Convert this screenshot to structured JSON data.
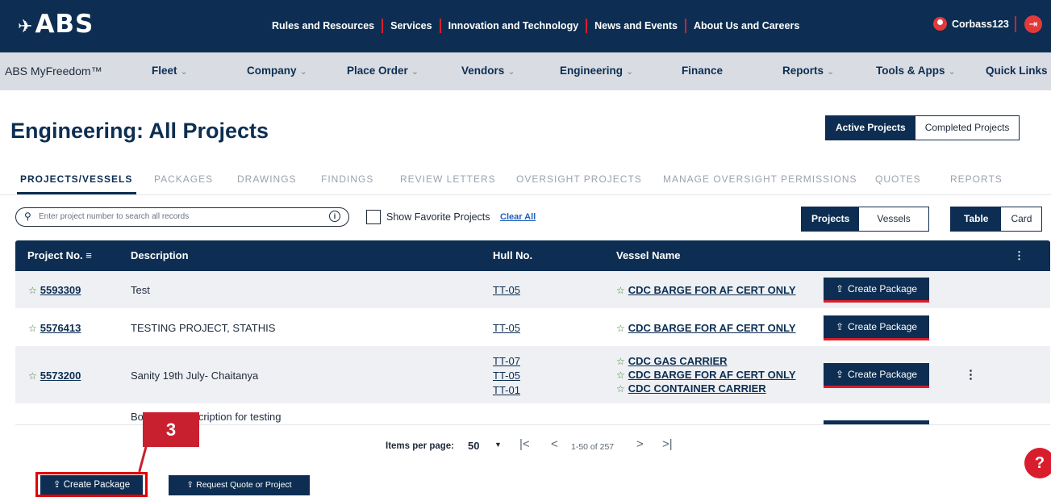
{
  "header": {
    "logo": "ABS",
    "nav": [
      "Rules and Resources",
      "Services",
      "Innovation and Technology",
      "News and Events",
      "About Us and Careers"
    ],
    "username": "Corbass123"
  },
  "subnav": {
    "brand": "ABS MyFreedom™",
    "items": [
      {
        "label": "Fleet",
        "dropdown": true
      },
      {
        "label": "Company",
        "dropdown": true
      },
      {
        "label": "Place Order",
        "dropdown": true
      },
      {
        "label": "Vendors",
        "dropdown": true
      },
      {
        "label": "Engineering",
        "dropdown": true
      },
      {
        "label": "Finance",
        "dropdown": false
      },
      {
        "label": "Reports",
        "dropdown": true
      },
      {
        "label": "Tools & Apps",
        "dropdown": true
      },
      {
        "label": "Quick Links",
        "dropdown": true
      }
    ]
  },
  "page": {
    "title": "Engineering: All Projects",
    "status_toggle": {
      "active": "Active Projects",
      "completed": "Completed Projects",
      "selected": "Active Projects"
    }
  },
  "tabs": [
    "PROJECTS/VESSELS",
    "PACKAGES",
    "DRAWINGS",
    "FINDINGS",
    "REVIEW LETTERS",
    "OVERSIGHT PROJECTS",
    "MANAGE OVERSIGHT PERMISSIONS",
    "QUOTES",
    "REPORTS"
  ],
  "active_tab": "PROJECTS/VESSELS",
  "filters": {
    "search_placeholder": "Enter project number to search all records",
    "favorite_label": "Show Favorite Projects",
    "clear_all": "Clear All",
    "type_toggle": {
      "projects": "Projects",
      "vessels": "Vessels",
      "selected": "Projects"
    },
    "view_toggle": {
      "table": "Table",
      "card": "Card",
      "selected": "Table"
    }
  },
  "table": {
    "columns": {
      "project_no": "Project No.",
      "description": "Description",
      "hull_no": "Hull No.",
      "vessel_name": "Vessel Name"
    },
    "rows": [
      {
        "project_no": "5593309",
        "description": "Test",
        "hulls": [
          "TT-05"
        ],
        "vessels": [
          "CDC BARGE FOR AF CERT ONLY"
        ],
        "action": "Create Package"
      },
      {
        "project_no": "5576413",
        "description": "TESTING PROJECT, STATHIS",
        "hulls": [
          "TT-05"
        ],
        "vessels": [
          "CDC BARGE FOR AF CERT ONLY"
        ],
        "action": "Create Package"
      },
      {
        "project_no": "5573200",
        "description": "Sanity 19th July- Chaitanya",
        "hulls": [
          "TT-07",
          "TT-05",
          "TT-01"
        ],
        "vessels": [
          "CDC GAS CARRIER",
          "CDC BARGE FOR AF CERT ONLY",
          "CDC CONTAINER CARRIER"
        ],
        "action": "Create Package"
      }
    ],
    "partial_row_text": "Bo          d description for testing"
  },
  "pagination": {
    "items_per_page_label": "Items per page:",
    "items_per_page": "50",
    "range": "1-50 of 257"
  },
  "annotation": {
    "step": "3"
  },
  "bottom_actions": {
    "create_package": "Create Package",
    "request_quote": "Request Quote or Project"
  },
  "help": "?",
  "colors": {
    "navy": "#0d2e52",
    "accent_red": "#d81e2c",
    "highlight": "#e00000"
  }
}
